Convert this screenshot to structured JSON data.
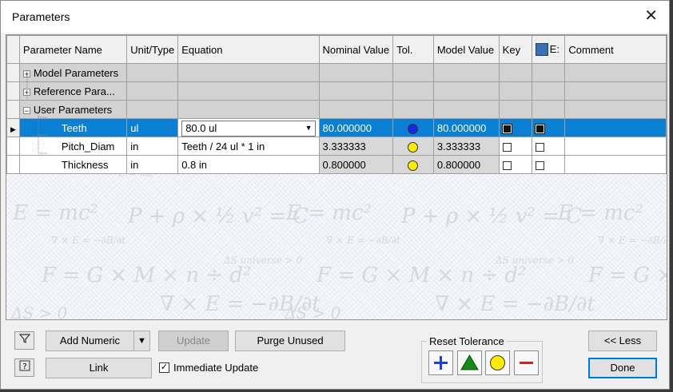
{
  "window": {
    "title": "Parameters",
    "close_glyph": "✕"
  },
  "columns": {
    "name": "Parameter Name",
    "unit": "Unit/Type",
    "equation": "Equation",
    "nominal": "Nominal Value",
    "tol": "Tol.",
    "model": "Model Value",
    "key": "Key",
    "export": "E:",
    "comment": "Comment"
  },
  "groups": [
    {
      "label": "Model Parameters",
      "expander": "+"
    },
    {
      "label": "Reference Para...",
      "expander": "+"
    },
    {
      "label": "User Parameters",
      "expander": "−"
    }
  ],
  "rows": [
    {
      "name": "Teeth",
      "unit": "ul",
      "equation": "80.0 ul",
      "nominal": "80.000000",
      "tol_color": "#1428e0",
      "model": "80.000000",
      "key": false,
      "export": false,
      "active": true
    },
    {
      "name": "Pitch_Diam",
      "unit": "in",
      "equation": "Teeth / 24 ul * 1 in",
      "nominal": "3.333333",
      "tol_color": "#ffeb00",
      "model": "3.333333",
      "key": false,
      "export": false,
      "active": false
    },
    {
      "name": "Thickness",
      "unit": "in",
      "equation": "0.8 in",
      "nominal": "0.800000",
      "tol_color": "#ffeb00",
      "model": "0.800000",
      "key": false,
      "export": false,
      "active": false
    }
  ],
  "buttons": {
    "filter_icon": "filter-icon",
    "add_numeric": "Add Numeric",
    "update": "Update",
    "purge_unused": "Purge Unused",
    "link": "Link",
    "immediate_update": "Immediate Update",
    "immediate_update_checked": true,
    "less": "<< Less",
    "done": "Done"
  },
  "reset_tolerance": {
    "label": "Reset Tolerance",
    "colors": {
      "plus": "#1f3fd6",
      "triangle": "#138a13",
      "circle": "#ffeb00",
      "minus": "#d42020"
    }
  }
}
